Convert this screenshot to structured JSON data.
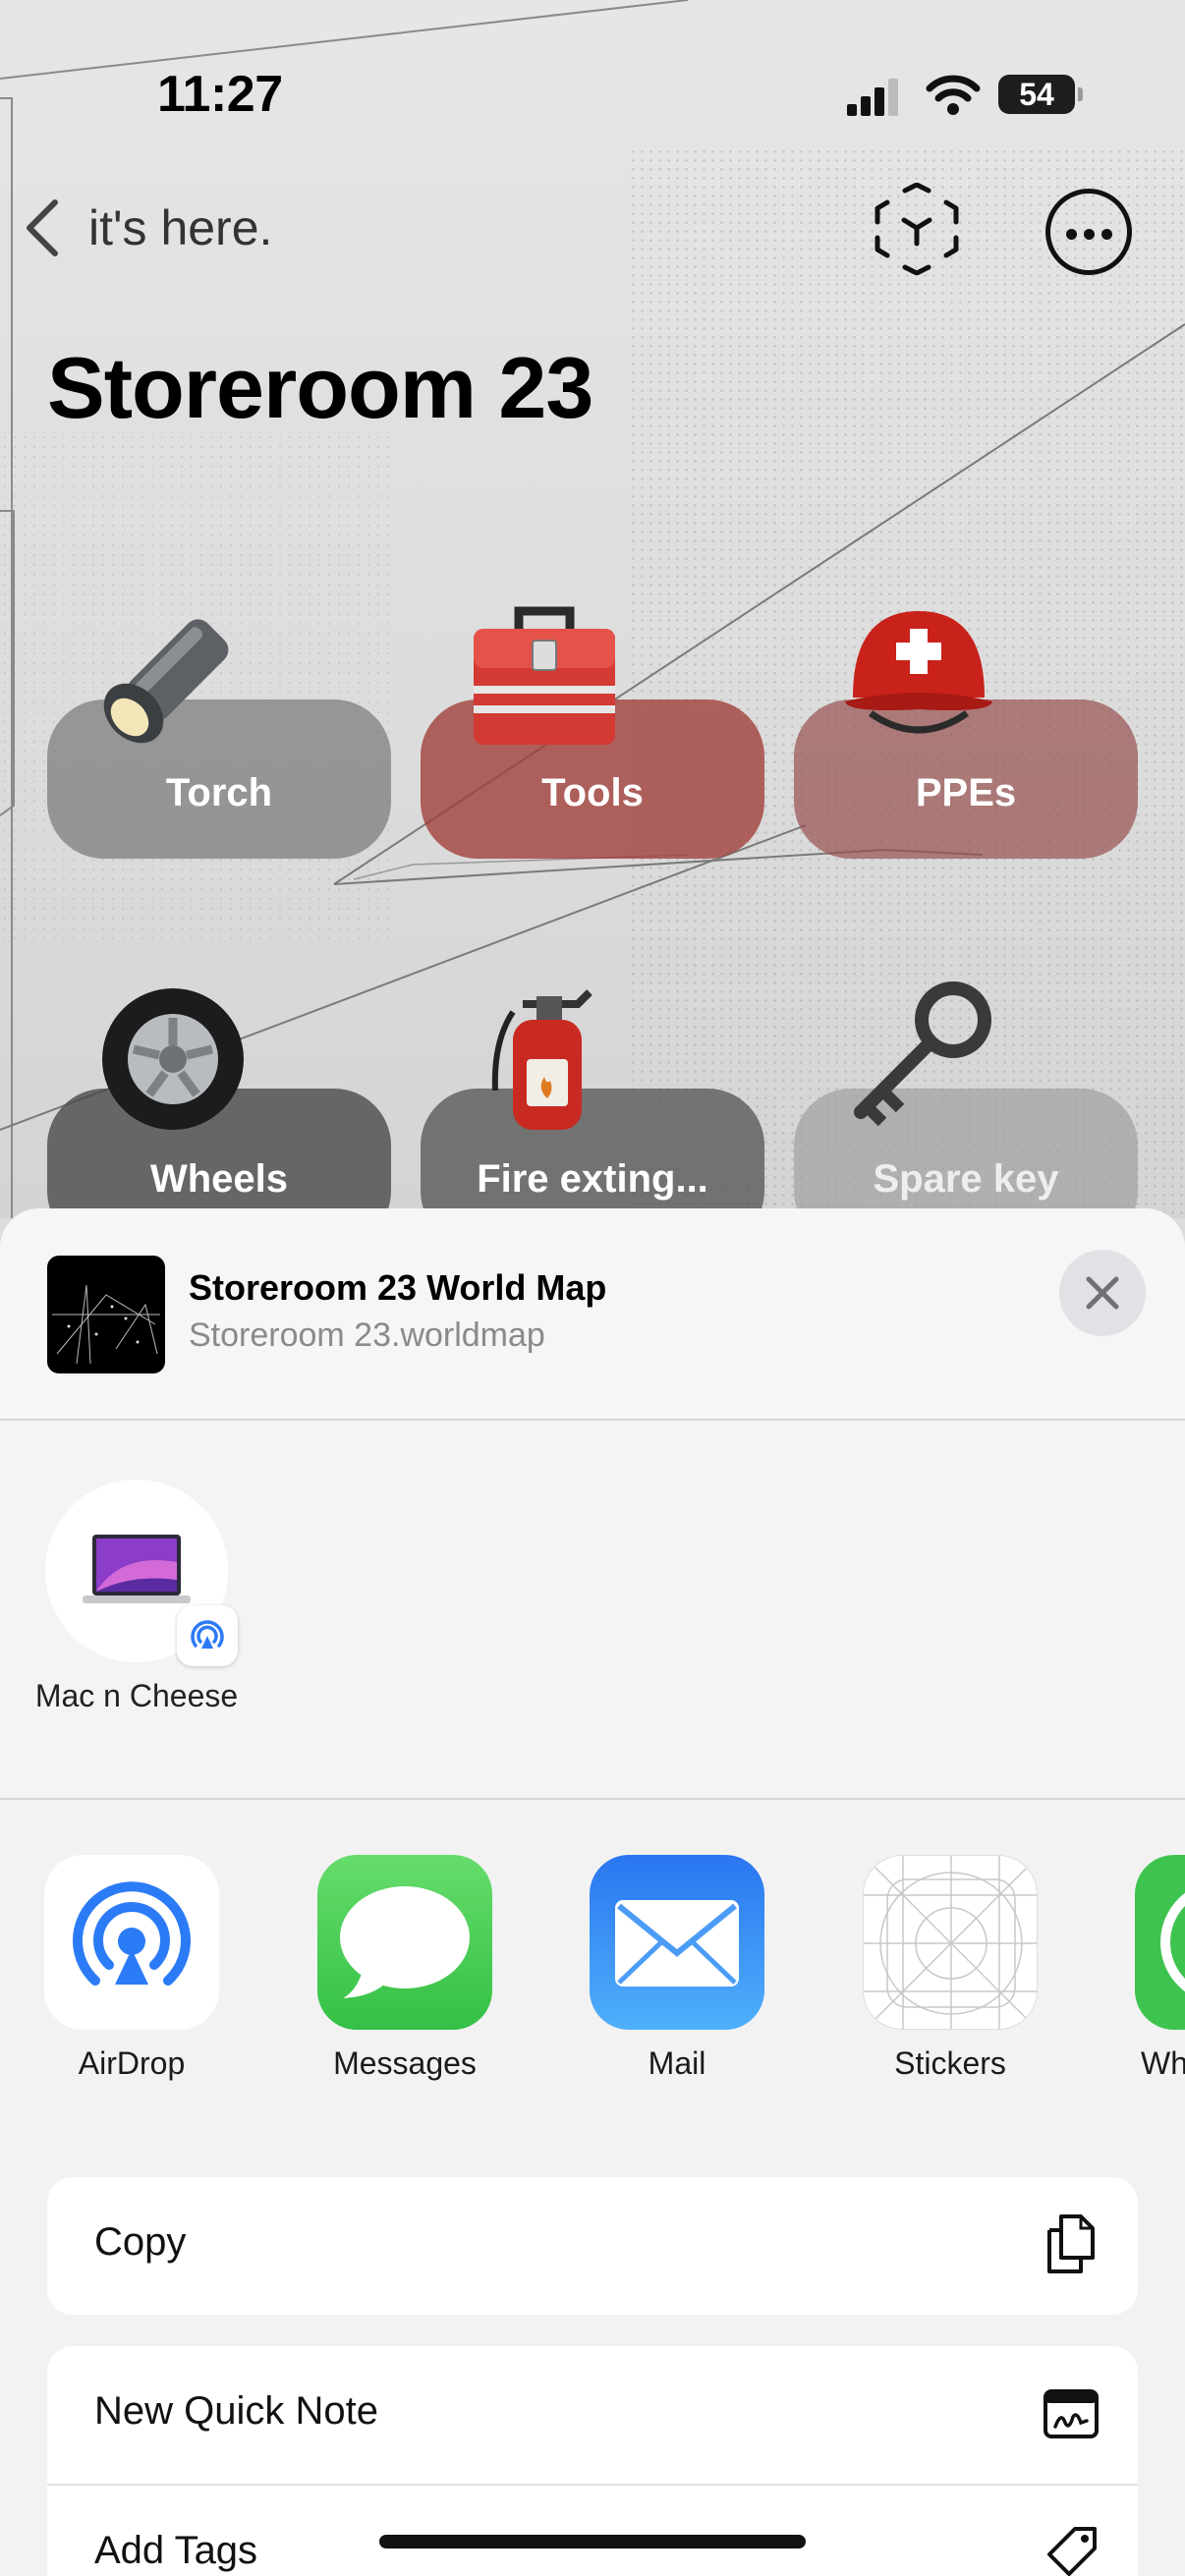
{
  "status_bar": {
    "time": "11:27",
    "battery": "54"
  },
  "nav": {
    "back_label": "it's here."
  },
  "page": {
    "title": "Storeroom 23"
  },
  "items": [
    {
      "label": "Torch",
      "icon": "flashlight-icon"
    },
    {
      "label": "Tools",
      "icon": "toolbox-icon"
    },
    {
      "label": "PPEs",
      "icon": "rescue-helmet-icon"
    },
    {
      "label": "Wheels",
      "icon": "wheel-icon"
    },
    {
      "label": "Fire exting...",
      "icon": "fire-extinguisher-icon"
    },
    {
      "label": "Spare key",
      "icon": "old-key-icon"
    }
  ],
  "share_sheet": {
    "file_title": "Storeroom 23 World Map",
    "file_name": "Storeroom 23.worldmap",
    "people": [
      {
        "name": "Mac n Cheese"
      }
    ],
    "apps": [
      {
        "name": "AirDrop"
      },
      {
        "name": "Messages"
      },
      {
        "name": "Mail"
      },
      {
        "name": "Stickers"
      },
      {
        "name": "Wh"
      }
    ],
    "actions": [
      {
        "label": "Copy",
        "icon": "copy-icon"
      },
      {
        "label": "New Quick Note",
        "icon": "quick-note-icon"
      },
      {
        "label": "Add Tags",
        "icon": "tag-icon"
      }
    ]
  },
  "colors": {
    "airdrop_blue": "#2c7bf6",
    "messages_green": "#3ec54a",
    "mail_blue": "#2d8bf8"
  }
}
